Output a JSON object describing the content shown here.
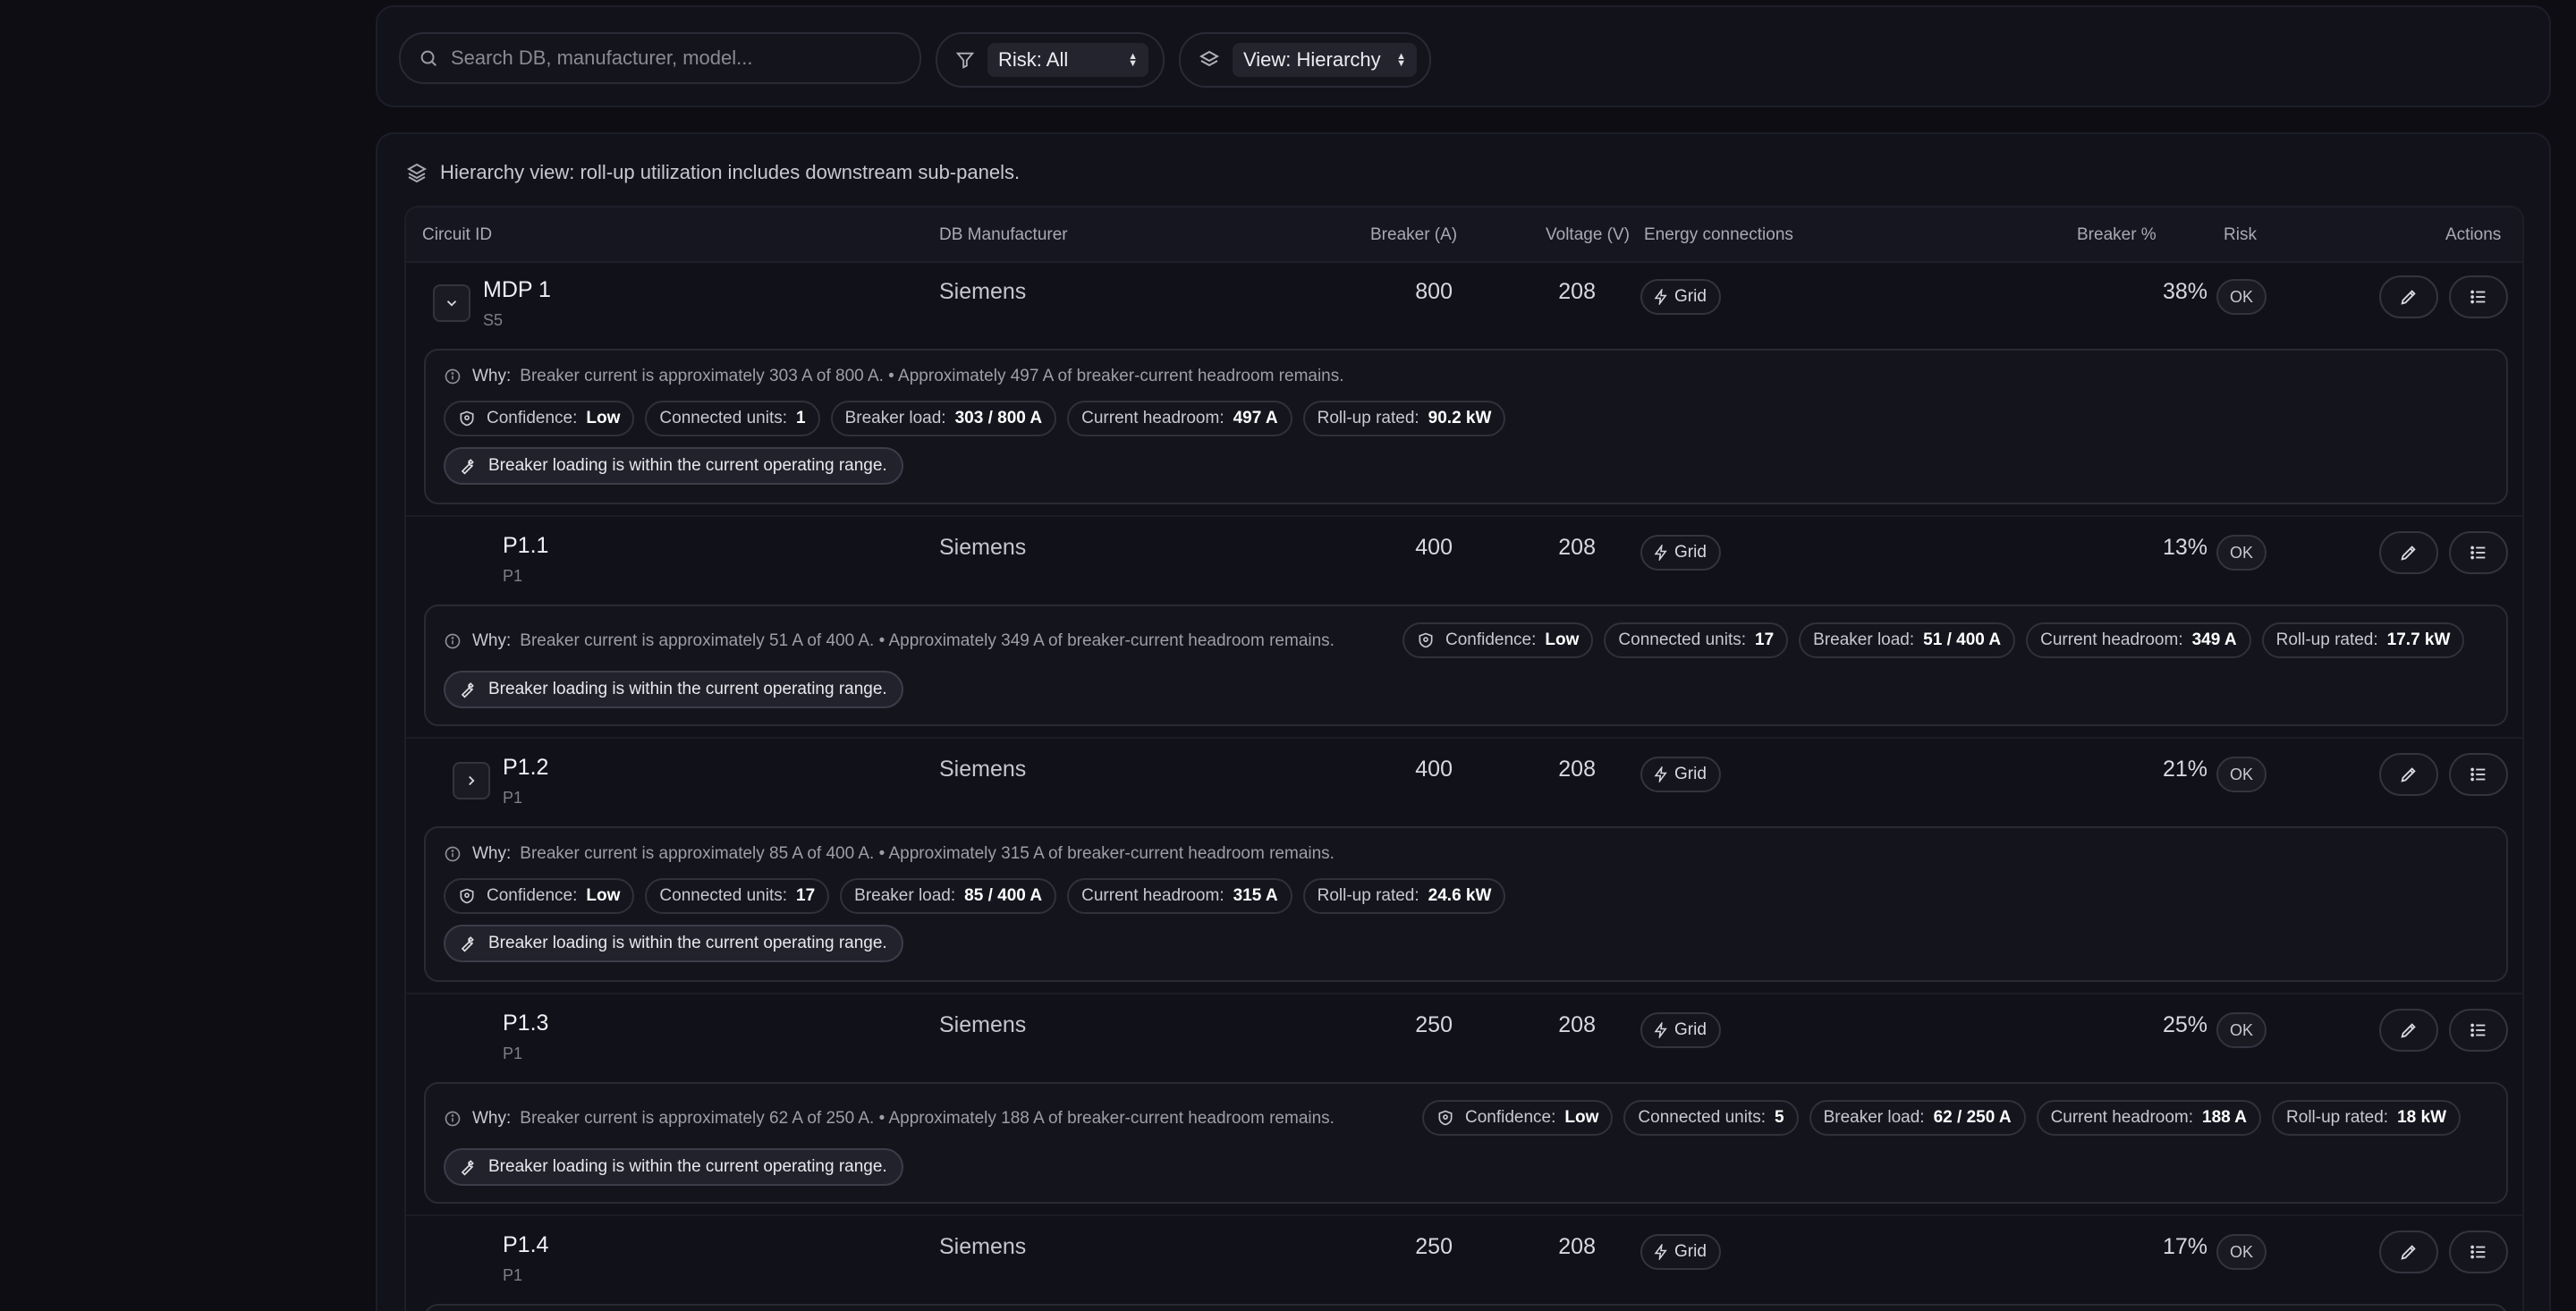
{
  "search": {
    "placeholder": "Search DB, manufacturer, model..."
  },
  "filters": {
    "risk_label": "Risk: All",
    "view_label": "View: Hierarchy"
  },
  "hierarchy_note": "Hierarchy view: roll-up utilization includes downstream sub-panels.",
  "columns": {
    "circuit_id": "Circuit ID",
    "manufacturer": "DB Manufacturer",
    "breaker": "Breaker (A)",
    "voltage": "Voltage (V)",
    "energy": "Energy connections",
    "breaker_pct": "Breaker %",
    "risk": "Risk",
    "actions": "Actions"
  },
  "labels": {
    "why": "Why:",
    "confidence": "Confidence:",
    "connected_units": "Connected units:",
    "breaker_load": "Breaker load:",
    "current_headroom": "Current headroom:",
    "rollup_rated": "Roll-up rated:"
  },
  "rows": [
    {
      "id": "MDP 1",
      "sub": "S5",
      "manufacturer": "Siemens",
      "breaker": "800",
      "voltage": "208",
      "energy": "Grid",
      "pct": "38%",
      "risk": "OK",
      "why": "Breaker current is approximately 303 A of 800 A. • Approximately 497 A of breaker-current headroom remains.",
      "confidence": "Low",
      "units": "1",
      "load": "303 / 800 A",
      "headroom": "497 A",
      "rollup": "90.2 kW",
      "status": "Breaker loading is within the current operating range.",
      "toggle": "expanded"
    },
    {
      "id": "P1.1",
      "sub": "P1",
      "manufacturer": "Siemens",
      "breaker": "400",
      "voltage": "208",
      "energy": "Grid",
      "pct": "13%",
      "risk": "OK",
      "why": "Breaker current is approximately 51 A of 400 A. • Approximately 349 A of breaker-current headroom remains.",
      "confidence": "Low",
      "units": "17",
      "load": "51 / 400 A",
      "headroom": "349 A",
      "rollup": "17.7 kW",
      "status": "Breaker loading is within the current operating range."
    },
    {
      "id": "P1.2",
      "sub": "P1",
      "manufacturer": "Siemens",
      "breaker": "400",
      "voltage": "208",
      "energy": "Grid",
      "pct": "21%",
      "risk": "OK",
      "why": "Breaker current is approximately 85 A of 400 A. • Approximately 315 A of breaker-current headroom remains.",
      "confidence": "Low",
      "units": "17",
      "load": "85 / 400 A",
      "headroom": "315 A",
      "rollup": "24.6 kW",
      "status": "Breaker loading is within the current operating range.",
      "toggle": "collapsed"
    },
    {
      "id": "P1.3",
      "sub": "P1",
      "manufacturer": "Siemens",
      "breaker": "250",
      "voltage": "208",
      "energy": "Grid",
      "pct": "25%",
      "risk": "OK",
      "why": "Breaker current is approximately 62 A of 250 A. • Approximately 188 A of breaker-current headroom remains.",
      "confidence": "Low",
      "units": "5",
      "load": "62 / 250 A",
      "headroom": "188 A",
      "rollup": "18 kW",
      "status": "Breaker loading is within the current operating range."
    },
    {
      "id": "P1.4",
      "sub": "P1",
      "manufacturer": "Siemens",
      "breaker": "250",
      "voltage": "208",
      "energy": "Grid",
      "pct": "17%",
      "risk": "OK"
    }
  ]
}
